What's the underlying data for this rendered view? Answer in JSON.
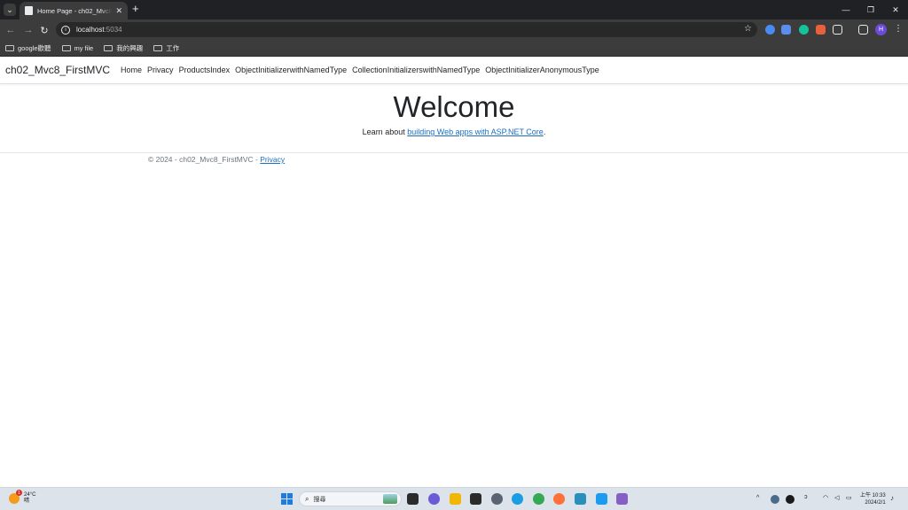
{
  "browser": {
    "tab_title": "Home Page - ch02_Mvc8_FirstMVC",
    "new_tab": "+",
    "url_host": "localhost",
    "url_port": ":5034",
    "profile_initial": "H",
    "bookmarks": [
      "google歡聽",
      "my file",
      "我的興趣",
      "工作"
    ]
  },
  "page": {
    "brand": "ch02_Mvc8_FirstMVC",
    "nav_links": [
      "Home",
      "Privacy",
      "ProductsIndex",
      "ObjectInitializerwithNamedType",
      "CollectionInitializerswithNamedType",
      "ObjectInitializerAnonymousType"
    ],
    "heading": "Welcome",
    "lead_prefix": "Learn about ",
    "lead_link": "building Web apps with ASP.NET Core",
    "lead_suffix": ".",
    "footer_text": "© 2024 - ch02_Mvc8_FirstMVC - ",
    "footer_link": "Privacy"
  },
  "taskbar": {
    "weather_badge": "1",
    "weather_temp": "24°C",
    "weather_cond": "晴",
    "search_placeholder": "搜尋",
    "clock_time": "上午 10:33",
    "clock_date": "2024/2/1"
  },
  "colors": {
    "link": "#1b6ec2",
    "chrome_dark": "#202124",
    "chrome_toolbar": "#3c3c3c",
    "taskbar": "#dde3ea"
  }
}
